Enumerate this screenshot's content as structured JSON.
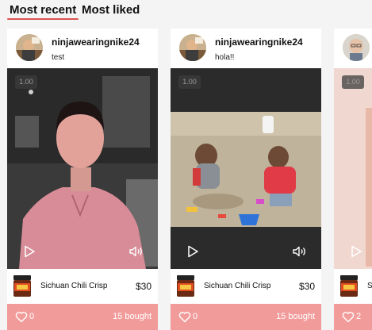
{
  "tabs": {
    "most_recent": "Most recent",
    "most_liked": "Most liked"
  },
  "cards": [
    {
      "username": "ninjawearingnike24",
      "caption": "test",
      "badge": "1.00",
      "product_name": "Sichuan Chili Crisp",
      "price": "$30",
      "likes": "0",
      "bought": "15 bought"
    },
    {
      "username": "ninjawearingnike24",
      "caption": "hola!!",
      "badge": "1.00",
      "product_name": "Sichuan Chili Crisp",
      "price": "$30",
      "likes": "0",
      "bought": "15 bought"
    },
    {
      "badge": "1.00",
      "product_name": "S",
      "likes": "2"
    }
  ],
  "colors": {
    "accent": "#d9534f",
    "footer": "#f29b9b"
  },
  "icons": [
    "play-icon",
    "sound-icon",
    "heart-icon",
    "chili-jar-icon"
  ]
}
